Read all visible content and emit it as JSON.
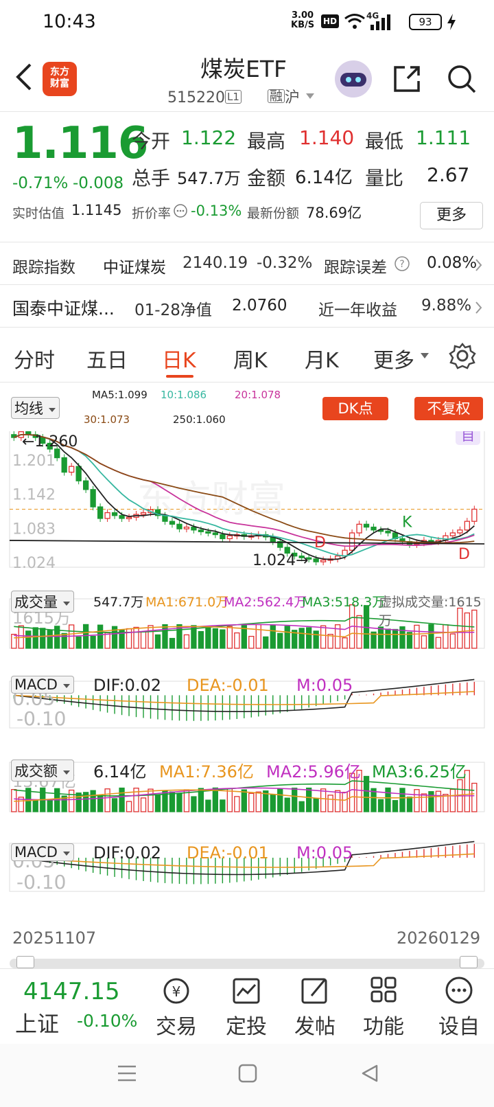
{
  "status": {
    "time": "10:43",
    "net_speed": "3.00",
    "net_unit": "KB/S",
    "hd": "HD",
    "signal": "4G",
    "battery": "93"
  },
  "header": {
    "title": "煤炭ETF",
    "code": "515220",
    "level_tag": "L1",
    "margin_tag": "融",
    "market_tag": "沪",
    "logo_line1": "东方",
    "logo_line2": "财富"
  },
  "quote": {
    "price": "1.116",
    "change_pct": "-0.71%",
    "change_abs": "-0.008",
    "open_label": "今开",
    "open": "1.122",
    "high_label": "最高",
    "high": "1.140",
    "low_label": "最低",
    "low": "1.111",
    "vol_label": "总手",
    "vol": "547.7万",
    "amount_label": "金额",
    "amount": "6.14亿",
    "ratio_label": "量比",
    "ratio": "2.67",
    "iopv_label": "实时估值",
    "iopv": "1.1145",
    "premium_label": "折价率",
    "premium": "-0.13%",
    "shares_label": "最新份额",
    "shares": "78.69亿",
    "more": "更多"
  },
  "tracking": {
    "label": "跟踪指数",
    "index": "中证煤炭",
    "index_val": "2140.19",
    "index_chg": "-0.32%",
    "error_label": "跟踪误差",
    "error": "0.08%"
  },
  "fund": {
    "name": "国泰中证煤...",
    "nav_label": "01-28净值",
    "nav": "2.0760",
    "ret_label": "近一年收益",
    "ret": "9.88%"
  },
  "tabs": [
    "分时",
    "五日",
    "日K",
    "周K",
    "月K",
    "更多"
  ],
  "kline": {
    "ma_select": "均线",
    "ma5": "MA5:1.099",
    "ma10": "10:1.086",
    "ma20": "20:1.078",
    "ma30": "30:1.073",
    "ma250": "250:1.060",
    "dk_btn": "DK点",
    "fq_btn": "不复权",
    "y_labels": [
      "1.260",
      "1.201",
      "1.142",
      "1.083",
      "1.024"
    ],
    "max_label": "1.260",
    "min_label": "1.024",
    "self_tag": "自",
    "k_mark": "K",
    "d_mark": "D",
    "watermark": "东方财富"
  },
  "volume": {
    "select": "成交量",
    "current": "547.7万",
    "ma1": "MA1:671.0万",
    "ma2": "MA2:562.4万",
    "ma3": "MA3:518.3万",
    "virtual": "虚拟成交量:1615万",
    "max_label": "1615万"
  },
  "macd1": {
    "select": "MACD",
    "dif": "DIF:0.02",
    "dea": "DEA:-0.01",
    "m": "M:0.05",
    "y1": "0.05",
    "y2": "-0.10"
  },
  "amount": {
    "select": "成交额",
    "current": "6.14亿",
    "ma1": "MA1:7.36亿",
    "ma2": "MA2:5.96亿",
    "ma3": "MA3:6.25亿",
    "max_label": "13.67亿"
  },
  "macd2": {
    "select": "MACD",
    "dif": "DIF:0.02",
    "dea": "DEA:-0.01",
    "m": "M:0.05",
    "y1": "0.05",
    "y2": "-0.10"
  },
  "dates": {
    "start": "20251107",
    "end": "20260129"
  },
  "bottom": {
    "index_val": "4147.15",
    "index_name": "上证",
    "index_chg": "-0.10%",
    "items": [
      "交易",
      "定投",
      "发帖",
      "功能",
      "设自"
    ]
  },
  "colors": {
    "up": "#e03030",
    "down": "#1a9b32",
    "accent": "#e8451e"
  }
}
